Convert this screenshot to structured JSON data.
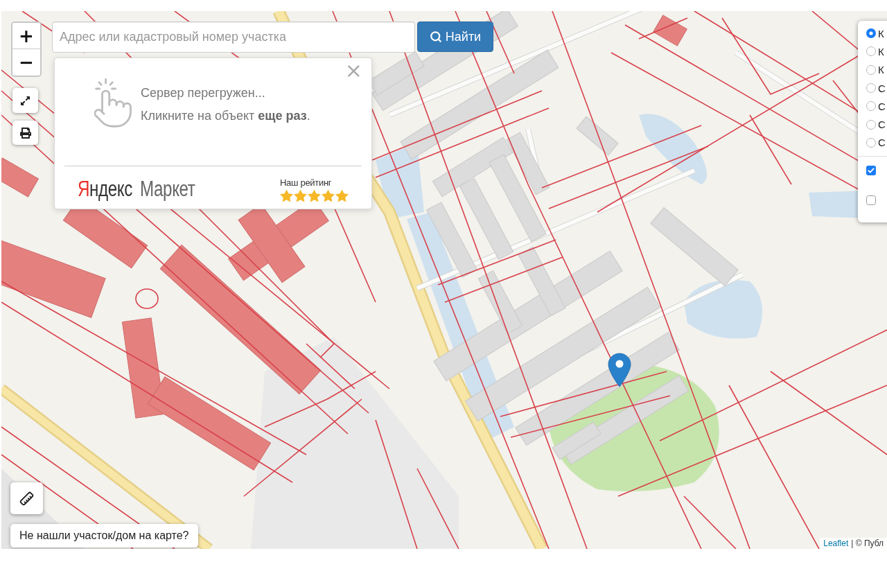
{
  "map": {
    "zoom": [
      "+",
      "−"
    ],
    "search": {
      "placeholder": "Адрес или кадастровый номер участка",
      "button": "Найти"
    },
    "popup": {
      "close": "×",
      "lines": [
        "Сервер перегружен...",
        "Кликните на объект **еще раз**."
      ],
      "logo": {
        "mark": "Я",
        "first": "ндекс",
        "second": "Маркет"
      },
      "rating_label": "Наш рейтинг",
      "stars": 5
    },
    "base_layers": [
      {
        "label": "К",
        "selected": true
      },
      {
        "label": "К",
        "selected": false
      },
      {
        "label": "К",
        "selected": false
      },
      {
        "label": "С",
        "selected": false
      },
      {
        "label": "С",
        "selected": false
      },
      {
        "label": "С",
        "selected": false
      },
      {
        "label": "С",
        "selected": false
      }
    ],
    "overlay_layers": [
      {
        "checked": true
      },
      {
        "checked": false
      }
    ],
    "not_found_button": "Не нашли участок/дом на карте?",
    "attribution": {
      "link": "Leaflet",
      "text": "| © Публ"
    }
  }
}
